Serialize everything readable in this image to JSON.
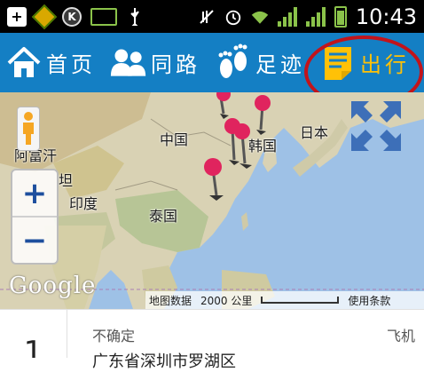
{
  "status_bar": {
    "time": "10:43",
    "icons": [
      "plus-box-icon",
      "diamond-app-icon",
      "k-app-icon",
      "bbm-icon",
      "usb-icon",
      "mute-icon",
      "alarm-icon",
      "wifi-icon",
      "signal-icon",
      "battery-charging-icon"
    ],
    "k_letter": "K",
    "plus_letter": "+"
  },
  "nav": {
    "items": [
      {
        "label": "首页",
        "icon": "home-icon"
      },
      {
        "label": "同路",
        "icon": "people-icon"
      },
      {
        "label": "足迹",
        "icon": "footprints-icon"
      },
      {
        "label": "出行",
        "icon": "notepad-icon",
        "active": true
      }
    ],
    "active_color": "#ffc107",
    "background": "#147fc4",
    "highlight_color": "#c2141b"
  },
  "map": {
    "labels": {
      "china": "中国",
      "korea": "韩国",
      "japan": "日本",
      "afghanistan": "阿富汗",
      "pakistan": "坦",
      "india": "印度",
      "thailand": "泰国"
    },
    "zoom_in": "+",
    "zoom_out": "−",
    "google_logo": "Google",
    "footer": {
      "map_data": "地图数据",
      "scale": "2000 公里",
      "terms": "使用条款"
    },
    "water_color": "#9ec1e6",
    "land_color": "#d9d2b4",
    "pin_color": "#e0245e"
  },
  "list": {
    "items": [
      {
        "index": "1",
        "status": "不确定",
        "type": "飞机",
        "title": "广东省深圳市罗湖区"
      }
    ]
  }
}
